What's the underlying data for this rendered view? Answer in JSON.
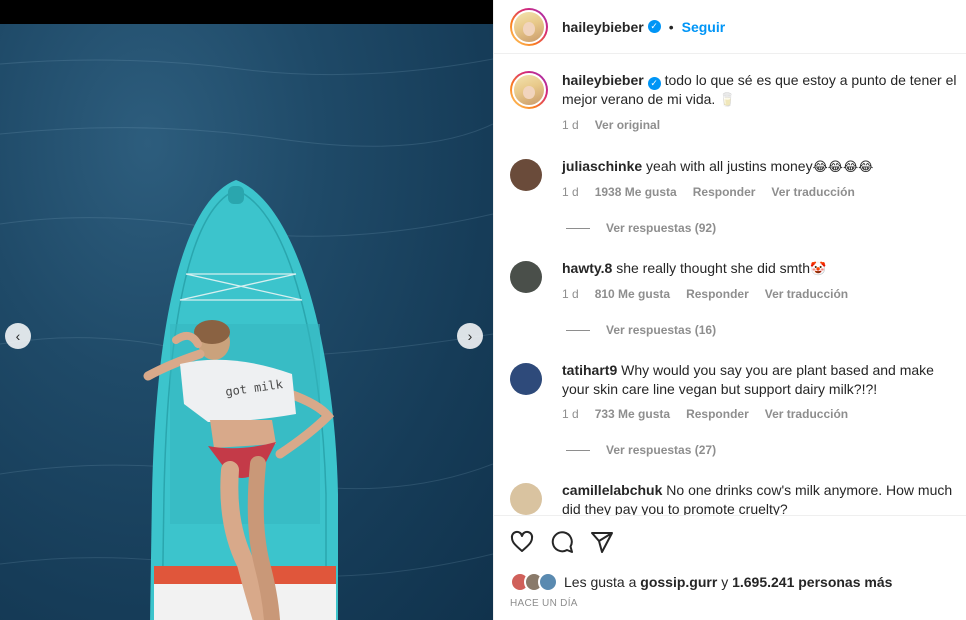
{
  "post": {
    "username": "haileybieber",
    "follow_label": "Seguir",
    "separator": "•",
    "verified_mark": "✓",
    "caption": "todo lo que sé es que estoy a punto de tener el mejor verano de mi vida.",
    "caption_emoji": "🥛",
    "caption_time": "1 d",
    "see_original_label": "Ver original"
  },
  "image": {
    "shirt_text": "got milk",
    "prev_icon": "chevron-left-icon",
    "next_icon": "chevron-right-icon",
    "prev_glyph": "‹",
    "next_glyph": "›"
  },
  "comments": [
    {
      "username": "juliaschinke",
      "text": "yeah with all justins money",
      "emojis": "😂😂😂😂",
      "time": "1 d",
      "likes": "1938 Me gusta",
      "reply_label": "Responder",
      "translate_label": "Ver traducción",
      "view_replies": "Ver respuestas (92)",
      "avatar_color": "#6a4b3a"
    },
    {
      "username": "hawty.8",
      "text": "she really thought she did smth",
      "emojis": "🤡",
      "time": "1 d",
      "likes": "810 Me gusta",
      "reply_label": "Responder",
      "translate_label": "Ver traducción",
      "view_replies": "Ver respuestas (16)",
      "avatar_color": "#4a4f4a"
    },
    {
      "username": "tatihart9",
      "text": "Why would you say you are plant based and make your skin care line vegan but support dairy milk?!?!",
      "emojis": "",
      "time": "1 d",
      "likes": "733 Me gusta",
      "reply_label": "Responder",
      "translate_label": "Ver traducción",
      "view_replies": "Ver respuestas (27)",
      "avatar_color": "#2e4a7a"
    },
    {
      "username": "camillelabchuk",
      "text": "No one drinks cow's milk anymore. How much did they pay you to promote cruelty?",
      "avatar_color": "#d9c3a0"
    }
  ],
  "footer": {
    "like_icon": "heart-icon",
    "comment_icon": "comment-icon",
    "share_icon": "share-icon",
    "likes_prefix": "Les gusta a",
    "likes_user": "gossip.gurr",
    "likes_connector": "y",
    "likes_count": "1.695.241 personas más",
    "time_ago": "HACE UN DÍA"
  },
  "colors": {
    "accent": "#0095f6",
    "muted": "#8e8e8e",
    "board": "#3cc4cc",
    "water": "#1f4a68"
  }
}
